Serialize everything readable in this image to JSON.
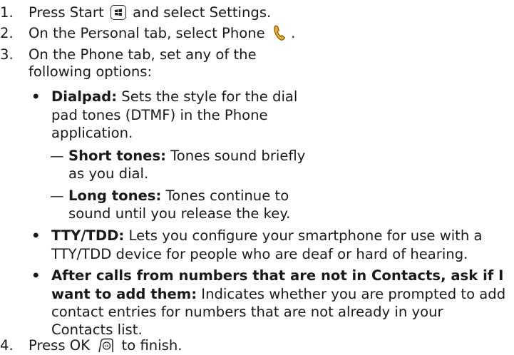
{
  "steps": {
    "s1": {
      "num": "1.",
      "text_a": "Press Start",
      "text_b": "and select Settings.",
      "icon": "start-key-icon"
    },
    "s2": {
      "num": "2.",
      "text_a": "On the Personal tab, select Phone",
      "text_b": ".",
      "icon": "phone-handset-icon"
    },
    "s3": {
      "num": "3.",
      "line1": "On the Phone tab, set any of the",
      "line2": "following options:"
    },
    "s4": {
      "num": "4.",
      "text_a": "Press OK",
      "text_b": "to finish.",
      "icon": "ok-key-icon"
    }
  },
  "options": {
    "dialpad": {
      "term": "Dialpad:",
      "line1": "Sets the style for the dial",
      "line2": "pad tones (DTMF) in the Phone",
      "line3": "application."
    },
    "short": {
      "dash": "—",
      "term": "Short tones:",
      "line1": "Tones sound briefly",
      "line2": "as you dial."
    },
    "long": {
      "dash": "—",
      "term": "Long tones:",
      "line1": "Tones continue to",
      "line2": "sound until you release the key."
    },
    "tty": {
      "term": "TTY/TDD:",
      "line1": "Lets you configure your smartphone for use with a",
      "line2": "TTY/TDD device for people who are deaf or hard of hearing."
    },
    "after": {
      "term1": "After calls from numbers that are not in Contacts, ask if I",
      "term2": "want to add them:",
      "line2": "Indicates whether you are prompted to add",
      "line3": "contact entries for numbers that are not already in your",
      "line4": "Contacts list."
    }
  },
  "colors": {
    "text": "#1a1a1a",
    "phone_icon": "#f2a81e"
  }
}
